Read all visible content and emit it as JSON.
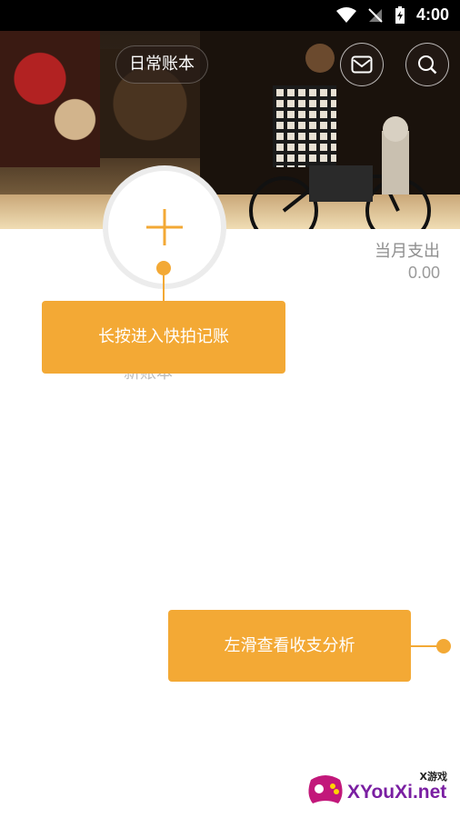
{
  "status_bar": {
    "time": "4:00"
  },
  "header": {
    "book_name": "日常账本",
    "icons": [
      "mail-icon",
      "search-icon"
    ]
  },
  "add_button": {
    "icon": "plus-icon"
  },
  "summary": {
    "label": "当月支出",
    "value": "0.00"
  },
  "ghost_text": "新账本",
  "tips": {
    "long_press": "长按进入快拍记账",
    "swipe_left": "左滑查看收支分析"
  },
  "watermark": {
    "small": "X游戏",
    "main": "XYouXi.net"
  },
  "colors": {
    "accent": "#f3a935"
  }
}
